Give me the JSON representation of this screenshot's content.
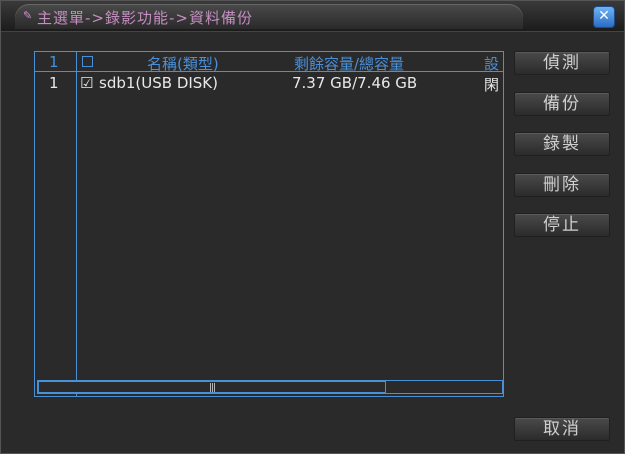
{
  "window": {
    "title": "主選單->錄影功能->資料備份",
    "close_glyph": "✕"
  },
  "table": {
    "header": {
      "index": "1",
      "checkbox": "",
      "name": "名稱(類型)",
      "capacity": "剩餘容量/總容量",
      "device": "設"
    },
    "rows": [
      {
        "index": "1",
        "checked": "☑",
        "name": "sdb1(USB DISK)",
        "capacity": "7.37 GB/7.46 GB",
        "device": "閑"
      }
    ]
  },
  "buttons": {
    "detect": "偵測",
    "backup": "備份",
    "record": "錄製",
    "delete": "刪除",
    "stop": "停止",
    "cancel": "取消"
  },
  "scrollbar": {
    "grip": "|||",
    "thumb_fraction": 0.75
  },
  "colors": {
    "accent": "#4a90d9",
    "title": "#c48ec0",
    "background": "#2a2a2a"
  },
  "icons": {
    "title": "pencil-icon",
    "close": "close-icon"
  }
}
